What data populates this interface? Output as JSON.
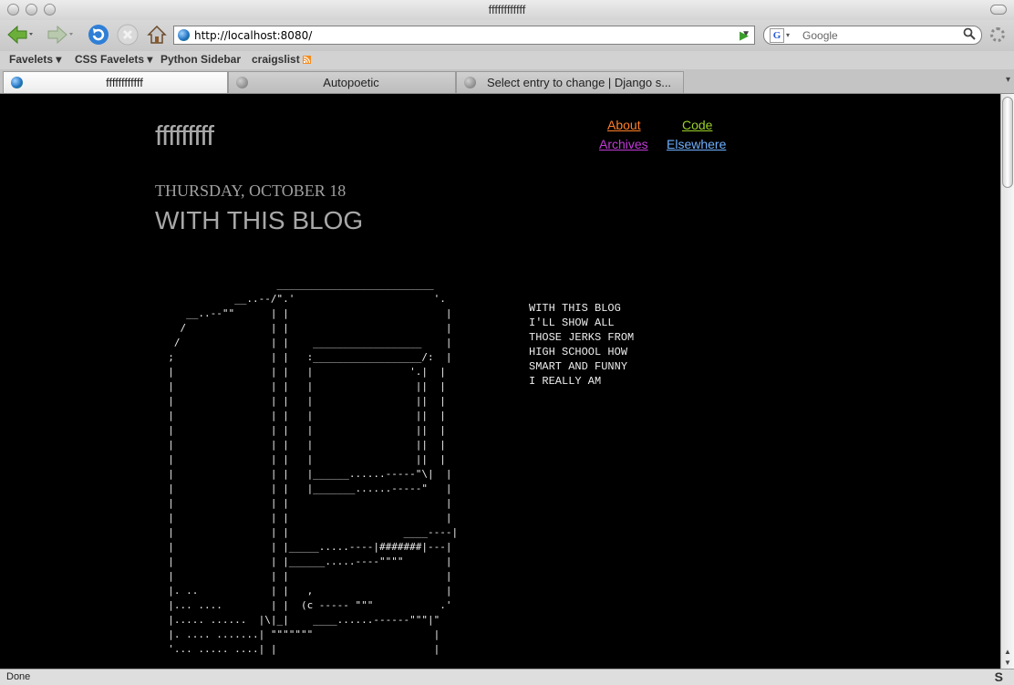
{
  "window": {
    "title": "ffffffffffff"
  },
  "toolbar": {
    "url": "http://localhost:8080/",
    "search_placeholder": "Google",
    "search_engine_letter": "G"
  },
  "bookmarks": [
    {
      "label": "Favelets ▾"
    },
    {
      "label": "CSS Favelets ▾"
    },
    {
      "label": "Python Sidebar"
    },
    {
      "label": "craigslist"
    }
  ],
  "tabs": [
    {
      "label": "ffffffffffff",
      "active": true
    },
    {
      "label": "Autopoetic",
      "active": false
    },
    {
      "label": "Select entry to change | Django s...",
      "active": false
    }
  ],
  "site": {
    "title": "fffffffff",
    "nav": [
      {
        "label": "About",
        "color": "#ff7f27"
      },
      {
        "label": "Code",
        "color": "#9bd22a"
      },
      {
        "label": "Archives",
        "color": "#c23bd8"
      },
      {
        "label": "Elsewhere",
        "color": "#6fb0ff"
      }
    ]
  },
  "post": {
    "date": "THURSDAY, OCTOBER 18",
    "title": "WITH THIS BLOG",
    "ascii_art": "                    __________________________\n             __..--/\".'                       '.\n     __..--\"\"      | |                          |\n    /              | |                          |\n   /               | |    __________________    |\n  ;                | |   :__________________/:  |\n  |                | |   |                '.|  |\n  |                | |   |                 ||  |\n  |                | |   |                 ||  |\n  |                | |   |                 ||  |\n  |                | |   |                 ||  |\n  |                | |   |                 ||  |\n  |                | |   |                 ||  |\n  |                | |   |______......-----\"\\|  |\n  |                | |   |_______......-----\"   |\n  |                | |                          |\n  |                | |                          |\n  |                | |                   ____----|\n  |                | |_____.....----|#######|---|\n  |                | |______.....----\"\"\"\"       |\n  |                | |                          |\n  |. ..            | |   ,                      |\n  |... ....        | |  (c ----- \"\"\"           .'\n  |..... ......  |\\|_|    ____......------\"\"\"|\"\n  |. .... .......| \"\"\"\"\"\"\"                    |\n  '... ..... ....| |                          |",
    "caption": "WITH THIS BLOG\nI'LL SHOW ALL\nTHOSE JERKS FROM\nHIGH SCHOOL HOW\nSMART AND FUNNY\nI REALLY AM"
  },
  "status": {
    "text": "Done"
  }
}
